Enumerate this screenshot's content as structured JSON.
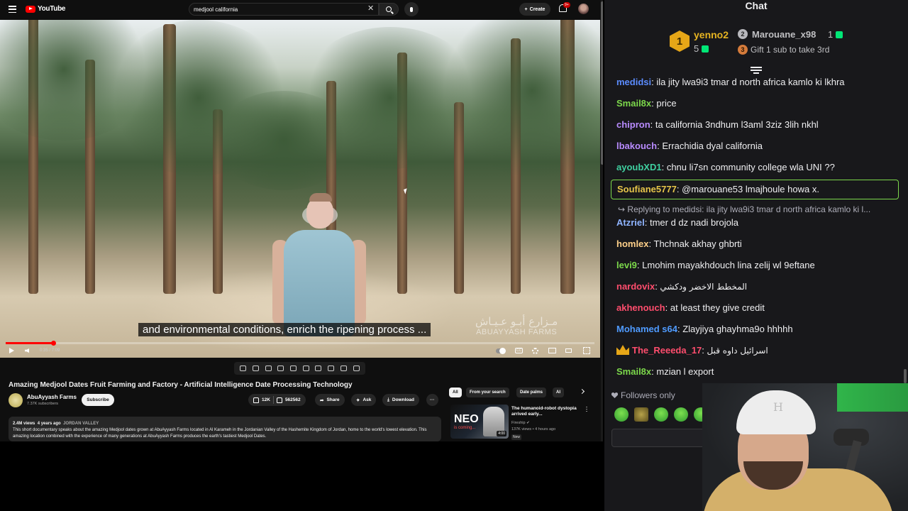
{
  "youtube": {
    "logo_text": "YouTube",
    "search": {
      "query": "medjool california"
    },
    "create_label": "Create",
    "notif_badge": "9+",
    "player": {
      "caption": "and environmental conditions, enrich the ripening process ...",
      "watermark_ar": "مـزارع أبـو عـيـاش",
      "watermark_en": "ABUAYYASH FARMS",
      "time": "0:35 / 7:09",
      "progress_fraction": 0.081
    },
    "video": {
      "title": "Amazing Medjool Dates Fruit Farming and Factory - Artificial Intelligence Date Processing Technology",
      "channel": "AbuAyyash Farms",
      "subscribers": "7.37K subscribers",
      "subscribe_label": "Subscribe",
      "likes": "12K",
      "dislikes": "562562",
      "share_label": "Share",
      "ask_label": "Ask",
      "download_label": "Download",
      "views": "2.4M views",
      "age": "4 years ago",
      "location_tag": "JORDAN VALLEY",
      "description": "This short documentary speaks about the amazing Medjool dates grown at AbuAyyash Farms located in Al Karameh in the Jordanian Valley of the Hashemite Kingdom of Jordan, home to the world's lowest elevation. This amazing location combined with the experience of many generations at AbuAyyash Farms produces the earth's tastiest Medjool Dates."
    },
    "chips": [
      "All",
      "From your search",
      "Date palms",
      "AI"
    ],
    "recommendation": {
      "title": "The humanoid-robot dystopia arrived early...",
      "channel": "Fireship",
      "views": "137K views",
      "age": "4 hours ago",
      "badge": "New",
      "duration": "4:00",
      "thumb_text": "NEO",
      "thumb_sub": "is coming..."
    }
  },
  "chat": {
    "title": "Chat",
    "leaderboard": {
      "first": {
        "rank": "1",
        "name": "yenno2",
        "count": "5"
      },
      "second": {
        "rank": "2",
        "name": "Marouane_x98",
        "count": "1"
      },
      "third": {
        "rank": "3",
        "text": "Gift 1 sub to take 3rd"
      }
    },
    "messages": [
      {
        "user": "medidsi",
        "color": "#5b8cff",
        "text": "ila jity lwa9i3 tmar d north africa kamlo ki lkhra"
      },
      {
        "user": "Smail8x",
        "color": "#7cd84b",
        "text": "price"
      },
      {
        "user": "chipron",
        "color": "#b98cff",
        "text": "ta california 3ndhum l3aml 3ziz 3lih nkhl"
      },
      {
        "user": "lbakouch",
        "color": "#b98cff",
        "text": "Errachidia dyal california"
      },
      {
        "user": "ayoubXD1",
        "color": "#3fd0a0",
        "text": "chnu li7sn community college wla UNI ??"
      },
      {
        "user": "Soufiane5777",
        "color": "#e6c54a",
        "text": "@marouane53 lmajhoule howa x."
      },
      {
        "user": "Atzriel",
        "color": "#8fb4ff",
        "text": "tmer d dz nadi brojola"
      },
      {
        "user": "homlex",
        "color": "#ffd08a",
        "text": "Thchnak akhay ghbrti"
      },
      {
        "user": "levi9",
        "color": "#7cd84b",
        "text": "Lmohim mayakhdouch lina zelij wl 9eftane"
      },
      {
        "user": "nardovix",
        "color": "#ff4d6d",
        "text": "المخطط الاخضر ودكشي"
      },
      {
        "user": "akhenouch",
        "color": "#ff4d6d",
        "text": "at least they give credit"
      },
      {
        "user": "Mohamed s64",
        "color": "#4f9bff",
        "text": "Zlayjiya ghayhma9o hhhhh"
      },
      {
        "user": "The_Reeeda_17",
        "color": "#ff4d6d",
        "text": "اسرائيل داوه قبل"
      },
      {
        "user": "Smail8x",
        "color": "#7cd84b",
        "text": "mzian l export"
      }
    ],
    "reply_to": "Replying to medidsi: ila jity lwa9i3 tmar d north africa kamlo ki l...",
    "followers_only": "Followers only",
    "hat_logo": "H"
  }
}
